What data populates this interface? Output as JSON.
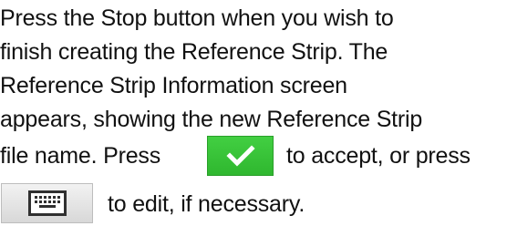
{
  "instruction": {
    "lines": [
      "Press the Stop button when you wish to",
      "finish creating the Reference Strip. The",
      "Reference Strip Information screen",
      "appears, showing the new Reference Strip"
    ],
    "line5_before": "file name. Press",
    "line5_after": "to accept, or press",
    "line6_after": "to edit, if necessary."
  },
  "icons": {
    "accept": "checkmark-icon",
    "edit": "keyboard-icon"
  },
  "colors": {
    "accept_button": "#35C135",
    "edit_button": "#E4E4E4",
    "text": "#111111"
  }
}
